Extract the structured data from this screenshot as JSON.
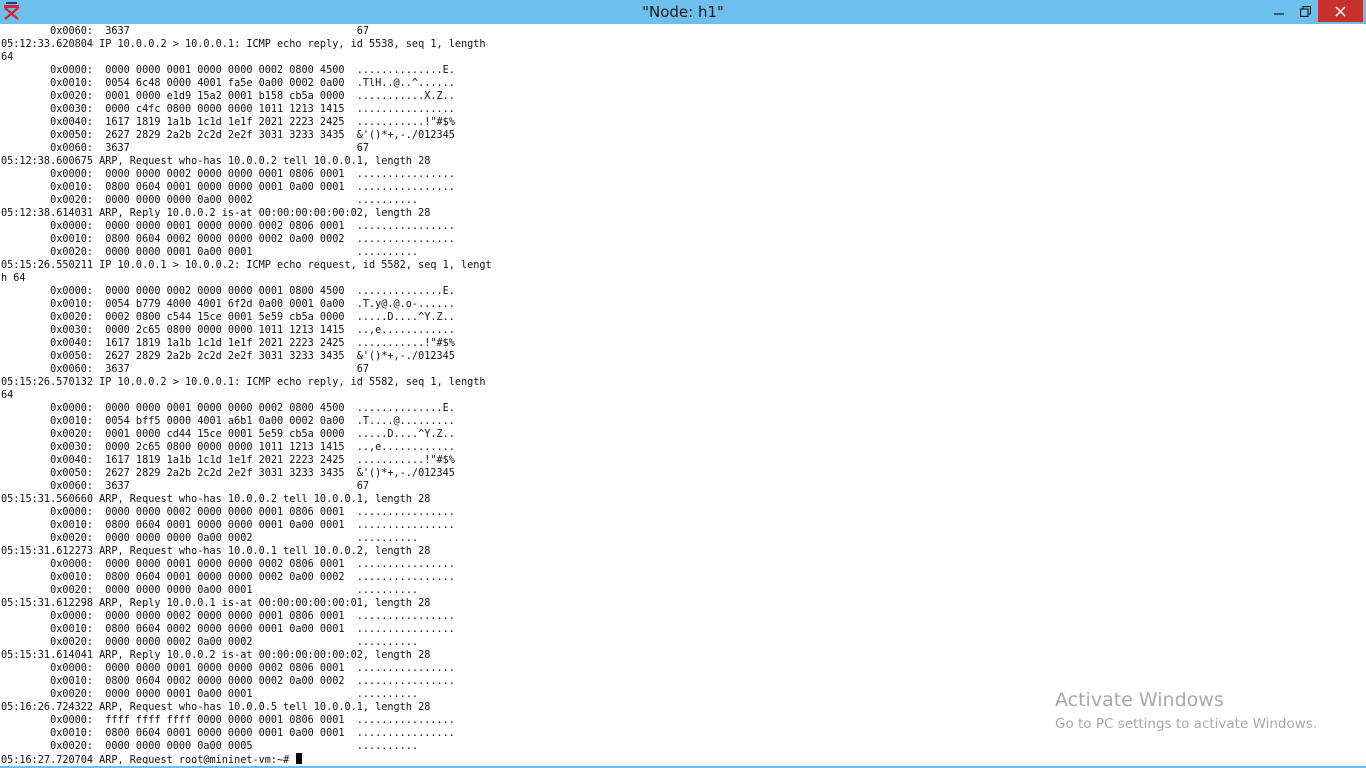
{
  "window": {
    "title": "\"Node: h1\"",
    "controls": {
      "minimize_icon": "minimize-icon",
      "maximize_icon": "restore-icon",
      "close_icon": "close-icon"
    },
    "colors": {
      "titlebar": "#6dbfee",
      "close": "#c7312b"
    }
  },
  "terminal": {
    "lines": [
      "        0x0060:  3637                                     67",
      "05:12:33.620804 IP 10.0.0.2 > 10.0.0.1: ICMP echo reply, id 5538, seq 1, length",
      "64",
      "        0x0000:  0000 0000 0001 0000 0000 0002 0800 4500  ..............E.",
      "        0x0010:  0054 6c48 0000 4001 fa5e 0a00 0002 0a00  .TlH..@..^......",
      "        0x0020:  0001 0000 e1d9 15a2 0001 b158 cb5a 0000  ...........X.Z..",
      "        0x0030:  0000 c4fc 0800 0000 0000 1011 1213 1415  ................",
      "        0x0040:  1617 1819 1a1b 1c1d 1e1f 2021 2223 2425  ...........!\"#$%",
      "        0x0050:  2627 2829 2a2b 2c2d 2e2f 3031 3233 3435  &'()*+,-./012345",
      "        0x0060:  3637                                     67",
      "05:12:38.600675 ARP, Request who-has 10.0.0.2 tell 10.0.0.1, length 28",
      "        0x0000:  0000 0000 0002 0000 0000 0001 0806 0001  ................",
      "        0x0010:  0800 0604 0001 0000 0000 0001 0a00 0001  ................",
      "        0x0020:  0000 0000 0000 0a00 0002                 ..........",
      "05:12:38.614031 ARP, Reply 10.0.0.2 is-at 00:00:00:00:00:02, length 28",
      "        0x0000:  0000 0000 0001 0000 0000 0002 0806 0001  ................",
      "        0x0010:  0800 0604 0002 0000 0000 0002 0a00 0002  ................",
      "        0x0020:  0000 0000 0001 0a00 0001                 ..........",
      "05:15:26.550211 IP 10.0.0.1 > 10.0.0.2: ICMP echo request, id 5582, seq 1, lengt",
      "h 64",
      "        0x0000:  0000 0000 0002 0000 0000 0001 0800 4500  ..............E.",
      "        0x0010:  0054 b779 4000 4001 6f2d 0a00 0001 0a00  .T.y@.@.o-......",
      "        0x0020:  0002 0800 c544 15ce 0001 5e59 cb5a 0000  .....D....^Y.Z..",
      "        0x0030:  0000 2c65 0800 0000 0000 1011 1213 1415  ..,e............",
      "        0x0040:  1617 1819 1a1b 1c1d 1e1f 2021 2223 2425  ...........!\"#$%",
      "        0x0050:  2627 2829 2a2b 2c2d 2e2f 3031 3233 3435  &'()*+,-./012345",
      "        0x0060:  3637                                     67",
      "05:15:26.570132 IP 10.0.0.2 > 10.0.0.1: ICMP echo reply, id 5582, seq 1, length",
      "64",
      "        0x0000:  0000 0000 0001 0000 0000 0002 0800 4500  ..............E.",
      "        0x0010:  0054 bff5 0000 4001 a6b1 0a00 0002 0a00  .T....@.........",
      "        0x0020:  0001 0000 cd44 15ce 0001 5e59 cb5a 0000  .....D....^Y.Z..",
      "        0x0030:  0000 2c65 0800 0000 0000 1011 1213 1415  ..,e............",
      "        0x0040:  1617 1819 1a1b 1c1d 1e1f 2021 2223 2425  ...........!\"#$%",
      "        0x0050:  2627 2829 2a2b 2c2d 2e2f 3031 3233 3435  &'()*+,-./012345",
      "        0x0060:  3637                                     67",
      "05:15:31.560660 ARP, Request who-has 10.0.0.2 tell 10.0.0.1, length 28",
      "        0x0000:  0000 0000 0002 0000 0000 0001 0806 0001  ................",
      "        0x0010:  0800 0604 0001 0000 0000 0001 0a00 0001  ................",
      "        0x0020:  0000 0000 0000 0a00 0002                 ..........",
      "05:15:31.612273 ARP, Request who-has 10.0.0.1 tell 10.0.0.2, length 28",
      "        0x0000:  0000 0000 0001 0000 0000 0002 0806 0001  ................",
      "        0x0010:  0800 0604 0001 0000 0000 0002 0a00 0002  ................",
      "        0x0020:  0000 0000 0000 0a00 0001                 ..........",
      "05:15:31.612298 ARP, Reply 10.0.0.1 is-at 00:00:00:00:00:01, length 28",
      "        0x0000:  0000 0000 0002 0000 0000 0001 0806 0001  ................",
      "        0x0010:  0800 0604 0002 0000 0000 0001 0a00 0001  ................",
      "        0x0020:  0000 0000 0002 0a00 0002                 ..........",
      "05:15:31.614041 ARP, Reply 10.0.0.2 is-at 00:00:00:00:00:02, length 28",
      "        0x0000:  0000 0000 0001 0000 0000 0002 0806 0001  ................",
      "        0x0010:  0800 0604 0002 0000 0000 0002 0a00 0002  ................",
      "        0x0020:  0000 0000 0001 0a00 0001                 ..........",
      "05:16:26.724322 ARP, Request who-has 10.0.0.5 tell 10.0.0.1, length 28",
      "        0x0000:  ffff ffff ffff 0000 0000 0001 0806 0001  ................",
      "        0x0010:  0800 0604 0001 0000 0000 0001 0a00 0001  ................",
      "        0x0020:  0000 0000 0000 0a00 0005                 .........."
    ],
    "prompt_line": "05:16:27.720704 ARP, Request root@mininet-vm:~# "
  },
  "watermark": {
    "title": "Activate Windows",
    "subtitle": "Go to PC settings to activate Windows."
  }
}
